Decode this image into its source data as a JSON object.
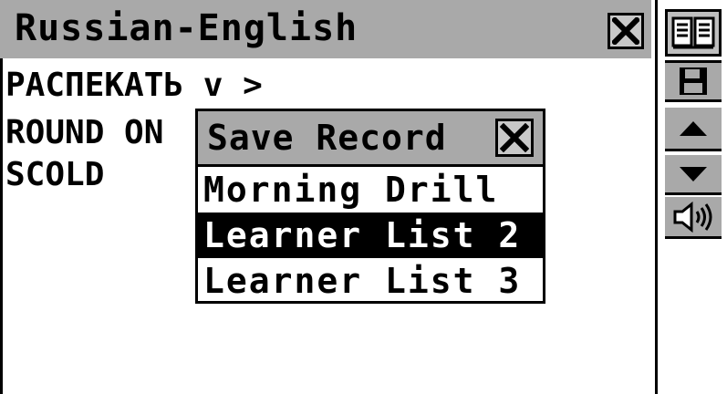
{
  "window": {
    "title": "Russian-English",
    "close_icon": "close-icon"
  },
  "entries": [
    "РАСПЕКАТЬ v >",
    "ROUND ON",
    "SCOLD"
  ],
  "toolbar": {
    "icons": [
      "book-icon",
      "save-icon",
      "arrow-up-icon",
      "arrow-down-icon",
      "speaker-icon"
    ]
  },
  "dialog": {
    "title": "Save Record",
    "options": [
      {
        "label": "Morning Drill",
        "selected": false
      },
      {
        "label": "Learner List 2",
        "selected": true
      },
      {
        "label": "Learner List 3",
        "selected": false
      }
    ]
  },
  "colors": {
    "titlebar_bg": "#a9a9a9",
    "selected_bg": "#000000",
    "selected_fg": "#ffffff"
  }
}
